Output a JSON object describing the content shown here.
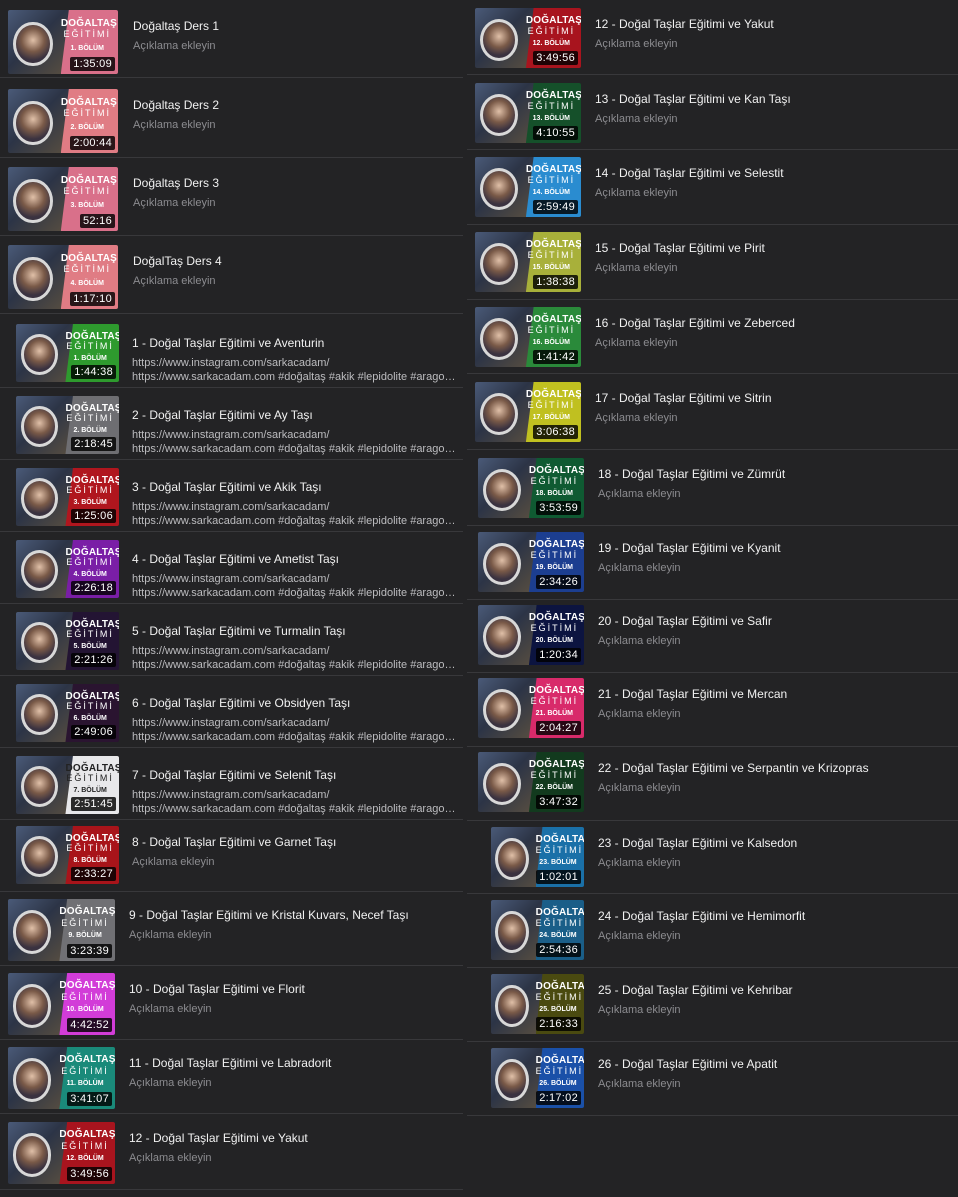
{
  "left": [
    {
      "title": "Doğaltaş Ders 1",
      "sub": "Açıklama ekleyin",
      "duration": "1:35:09",
      "badge": "DOĞALTAŞ",
      "brand": "EĞİTİMİ",
      "episode": "1. BÖLÜM",
      "color": "#d9708a"
    },
    {
      "title": "Doğaltaş Ders 2",
      "sub": "Açıklama ekleyin",
      "duration": "2:00:44",
      "badge": "DOĞALTAŞ",
      "brand": "EĞİTİMİ",
      "episode": "2. BÖLÜM",
      "color": "#e07c84"
    },
    {
      "title": "Doğaltaş Ders 3",
      "sub": "Açıklama ekleyin",
      "duration": "52:16",
      "badge": "DOĞALTAŞ",
      "brand": "EĞİTİMİ",
      "episode": "3. BÖLÜM",
      "color": "#d9708a"
    },
    {
      "title": "DoğalTaş Ders 4",
      "sub": "Açıklama ekleyin",
      "duration": "1:17:10",
      "badge": "DOĞALTAŞ",
      "brand": "EĞİTİMİ",
      "episode": "4. BÖLÜM",
      "color": "#e07c84"
    },
    {
      "title": "1 - Doğal Taşlar Eğitimi ve Aventurin",
      "link1": "https://www.instagram.com/sarkacadam/",
      "link2": "https://www.sarkacadam.com #doğaltaş #akik #lepidolite #aragonite...",
      "duration": "1:44:38",
      "badge": "DOĞALTAŞ",
      "brand": "EĞİTİMİ",
      "episode": "1. BÖLÜM",
      "color": "#2e9a2e"
    },
    {
      "title": "2 - Doğal Taşlar Eğitimi ve Ay Taşı",
      "link1": "https://www.instagram.com/sarkacadam/",
      "link2": "https://www.sarkacadam.com #doğaltaş #akik #lepidolite #aragonite...",
      "duration": "2:18:45",
      "badge": "DOĞALTAŞ",
      "brand": "EĞİTİMİ",
      "episode": "2. BÖLÜM",
      "color": "#6e6e72"
    },
    {
      "title": "3 - Doğal Taşlar Eğitimi ve Akik Taşı",
      "link1": "https://www.instagram.com/sarkacadam/",
      "link2": "https://www.sarkacadam.com #doğaltaş #akik #lepidolite #aragonite...",
      "duration": "1:25:06",
      "badge": "DOĞALTAŞ",
      "brand": "EĞİTİMİ",
      "episode": "3. BÖLÜM",
      "color": "#b0161e"
    },
    {
      "title": "4 - Doğal Taşlar Eğitimi ve Ametist Taşı",
      "link1": "https://www.instagram.com/sarkacadam/",
      "link2": "https://www.sarkacadam.com #doğaltaş #akik #lepidolite #aragonite...",
      "duration": "2:26:18",
      "badge": "DOĞALTAŞ",
      "brand": "EĞİTİMİ",
      "episode": "4. BÖLÜM",
      "color": "#7a1ea6"
    },
    {
      "title": "5 - Doğal Taşlar Eğitimi ve Turmalin Taşı",
      "link1": "https://www.instagram.com/sarkacadam/",
      "link2": "https://www.sarkacadam.com #doğaltaş #akik #lepidolite #aragonite...",
      "duration": "2:21:26",
      "badge": "DOĞALTAŞ",
      "brand": "EĞİTİMİ",
      "episode": "5. BÖLÜM",
      "color": "#231433"
    },
    {
      "title": "6 - Doğal Taşlar Eğitimi ve Obsidyen Taşı",
      "link1": "https://www.instagram.com/sarkacadam/",
      "link2": "https://www.sarkacadam.com #doğaltaş #akik #lepidolite #aragonite...",
      "duration": "2:49:06",
      "badge": "DOĞALTAŞ",
      "brand": "EĞİTİMİ",
      "episode": "6. BÖLÜM",
      "color": "#2a1430"
    },
    {
      "title": "7 - Doğal Taşlar Eğitimi ve Selenit Taşı",
      "link1": "https://www.instagram.com/sarkacadam/",
      "link2": "https://www.sarkacadam.com #doğaltaş #akik #lepidolite #aragonite...",
      "duration": "2:51:45",
      "badge": "DOĞALTAŞ",
      "brand": "EĞİTİMİ",
      "episode": "7. BÖLÜM",
      "color": "#e8e8ea"
    },
    {
      "title": "8 - Doğal Taşlar Eğitimi ve Garnet Taşı",
      "sub": "Açıklama ekleyin",
      "duration": "2:33:27",
      "badge": "DOĞALTAŞ",
      "brand": "EĞİTİMİ",
      "episode": "8. BÖLÜM",
      "color": "#a8141a"
    },
    {
      "title": "9 - Doğal Taşlar Eğitimi ve Kristal Kuvars, Necef Taşı",
      "sub": "Açıklama ekleyin",
      "duration": "3:23:39",
      "badge": "DOĞALTAŞ",
      "brand": "EĞİTİMİ",
      "episode": "9. BÖLÜM",
      "color": "#707074"
    },
    {
      "title": "10 - Doğal Taşlar Eğitimi ve Florit",
      "sub": "Açıklama ekleyin",
      "duration": "4:42:52",
      "badge": "DOĞALTAŞ",
      "brand": "EĞİTİMİ",
      "episode": "10. BÖLÜM",
      "color": "#d23cd8"
    },
    {
      "title": "11 - Doğal Taşlar Eğitimi ve Labradorit",
      "sub": "Açıklama ekleyin",
      "duration": "3:41:07",
      "badge": "DOĞALTAŞ",
      "brand": "EĞİTİMİ",
      "episode": "11. BÖLÜM",
      "color": "#1a8a7a"
    },
    {
      "title": "12 - Doğal Taşlar Eğitimi ve Yakut",
      "sub": "Açıklama ekleyin",
      "duration": "3:49:56",
      "badge": "DOĞALTAŞ",
      "brand": "EĞİTİMİ",
      "episode": "12. BÖLÜM",
      "color": "#a8141e"
    }
  ],
  "right": [
    {
      "title": "12 - Doğal Taşlar Eğitimi ve Yakut",
      "sub": "Açıklama ekleyin",
      "duration": "3:49:56",
      "badge": "DOĞALTAŞ",
      "brand": "EĞİTİMİ",
      "episode": "12. BÖLÜM",
      "color": "#a8141e"
    },
    {
      "title": "13 - Doğal Taşlar Eğitimi ve Kan Taşı",
      "sub": "Açıklama ekleyin",
      "duration": "4:10:55",
      "badge": "DOĞALTAŞ",
      "brand": "EĞİTİMİ",
      "episode": "13. BÖLÜM",
      "color": "#15502a"
    },
    {
      "title": "14 - Doğal Taşlar Eğitimi ve Selestit",
      "sub": "Açıklama ekleyin",
      "duration": "2:59:49",
      "badge": "DOĞALTAŞ",
      "brand": "EĞİTİMİ",
      "episode": "14. BÖLÜM",
      "color": "#2a8cd0"
    },
    {
      "title": "15 - Doğal Taşlar Eğitimi ve Pirit",
      "sub": "Açıklama ekleyin",
      "duration": "1:38:38",
      "badge": "DOĞALTAŞ",
      "brand": "EĞİTİMİ",
      "episode": "15. BÖLÜM",
      "color": "#a8b03a"
    },
    {
      "title": "16 - Doğal Taşlar Eğitimi ve Zeberced",
      "sub": "Açıklama ekleyin",
      "duration": "1:41:42",
      "badge": "DOĞALTAŞ",
      "brand": "EĞİTİMİ",
      "episode": "16. BÖLÜM",
      "color": "#2a8a3a"
    },
    {
      "title": "17 - Doğal Taşlar Eğitimi ve Sitrin",
      "sub": "Açıklama ekleyin",
      "duration": "3:06:38",
      "badge": "DOĞALTAŞ",
      "brand": "EĞİTİMİ",
      "episode": "17. BÖLÜM",
      "color": "#c0c020"
    },
    {
      "title": "18 - Doğal Taşlar Eğitimi ve Zümrüt",
      "sub": "Açıklama ekleyin",
      "duration": "3:53:59",
      "badge": "DOĞALTAŞ",
      "brand": "EĞİTİMİ",
      "episode": "18. BÖLÜM",
      "color": "#0f5a32"
    },
    {
      "title": "19 - Doğal Taşlar Eğitimi ve Kyanit",
      "sub": "Açıklama ekleyin",
      "duration": "2:34:26",
      "badge": "DOĞALTAŞ",
      "brand": "EĞİTİMİ",
      "episode": "19. BÖLÜM",
      "color": "#1c3e90"
    },
    {
      "title": "20 - Doğal Taşlar Eğitimi ve Safir",
      "sub": "Açıklama ekleyin",
      "duration": "1:20:34",
      "badge": "DOĞALTAŞ",
      "brand": "EĞİTİMİ",
      "episode": "20. BÖLÜM",
      "color": "#0c1440"
    },
    {
      "title": "21 - Doğal Taşlar Eğitimi ve Mercan",
      "sub": "Açıklama ekleyin",
      "duration": "2:04:27",
      "badge": "DOĞALTAŞ",
      "brand": "EĞİTİMİ",
      "episode": "21. BÖLÜM",
      "color": "#d82a6a"
    },
    {
      "title": "22 - Doğal Taşlar Eğitimi ve Serpantin ve Krizopras",
      "sub": "Açıklama ekleyin",
      "duration": "3:47:32",
      "badge": "DOĞALTAŞ",
      "brand": "EĞİTİMİ",
      "episode": "22. BÖLÜM",
      "color": "#123a1e"
    },
    {
      "title": "23 - Doğal Taşlar Eğitimi ve Kalsedon",
      "sub": "Açıklama ekleyin",
      "duration": "1:02:01",
      "badge": "DOĞALTAŞ",
      "brand": "EĞİTİMİ",
      "episode": "23. BÖLÜM",
      "color": "#1a70a8"
    },
    {
      "title": "24 - Doğal Taşlar Eğitimi ve Hemimorfit",
      "sub": "Açıklama ekleyin",
      "duration": "2:54:36",
      "badge": "DOĞALTAŞ",
      "brand": "EĞİTİMİ",
      "episode": "24. BÖLÜM",
      "color": "#1a5e88"
    },
    {
      "title": "25 - Doğal Taşlar Eğitimi ve Kehribar",
      "sub": "Açıklama ekleyin",
      "duration": "2:16:33",
      "badge": "DOĞALTAŞ",
      "brand": "EĞİTİMİ",
      "episode": "25. BÖLÜM",
      "color": "#4a4a10"
    },
    {
      "title": "26 - Doğal Taşlar Eğitimi ve Apatit",
      "sub": "Açıklama ekleyin",
      "duration": "2:17:02",
      "badge": "DOĞALTAŞ",
      "brand": "EĞİTİMİ",
      "episode": "26. BÖLÜM",
      "color": "#1a50a8"
    }
  ]
}
